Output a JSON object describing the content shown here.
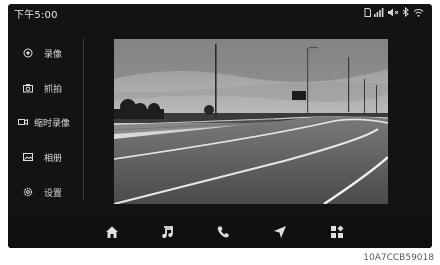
{
  "status": {
    "time": "下午5:00",
    "icons": [
      "sd-card-icon",
      "signal-icon",
      "mute-icon",
      "bluetooth-icon",
      "wifi-icon"
    ]
  },
  "sidebar": {
    "items": [
      {
        "label": "录像",
        "icon": "record-icon"
      },
      {
        "label": "抓拍",
        "icon": "camera-icon"
      },
      {
        "label": "缩时录像",
        "icon": "timelapse-icon"
      },
      {
        "label": "相册",
        "icon": "album-icon"
      },
      {
        "label": "设置",
        "icon": "settings-icon"
      }
    ]
  },
  "viewport": {
    "description_icon": "dashcam-live-view"
  },
  "navbar": {
    "items": [
      "home-icon",
      "music-icon",
      "phone-icon",
      "navigation-icon",
      "apps-icon"
    ]
  },
  "caption": "10A7CCB59018",
  "colors": {
    "background": "#131313",
    "text": "#dcdcdc",
    "icon": "#e0e0e0"
  }
}
